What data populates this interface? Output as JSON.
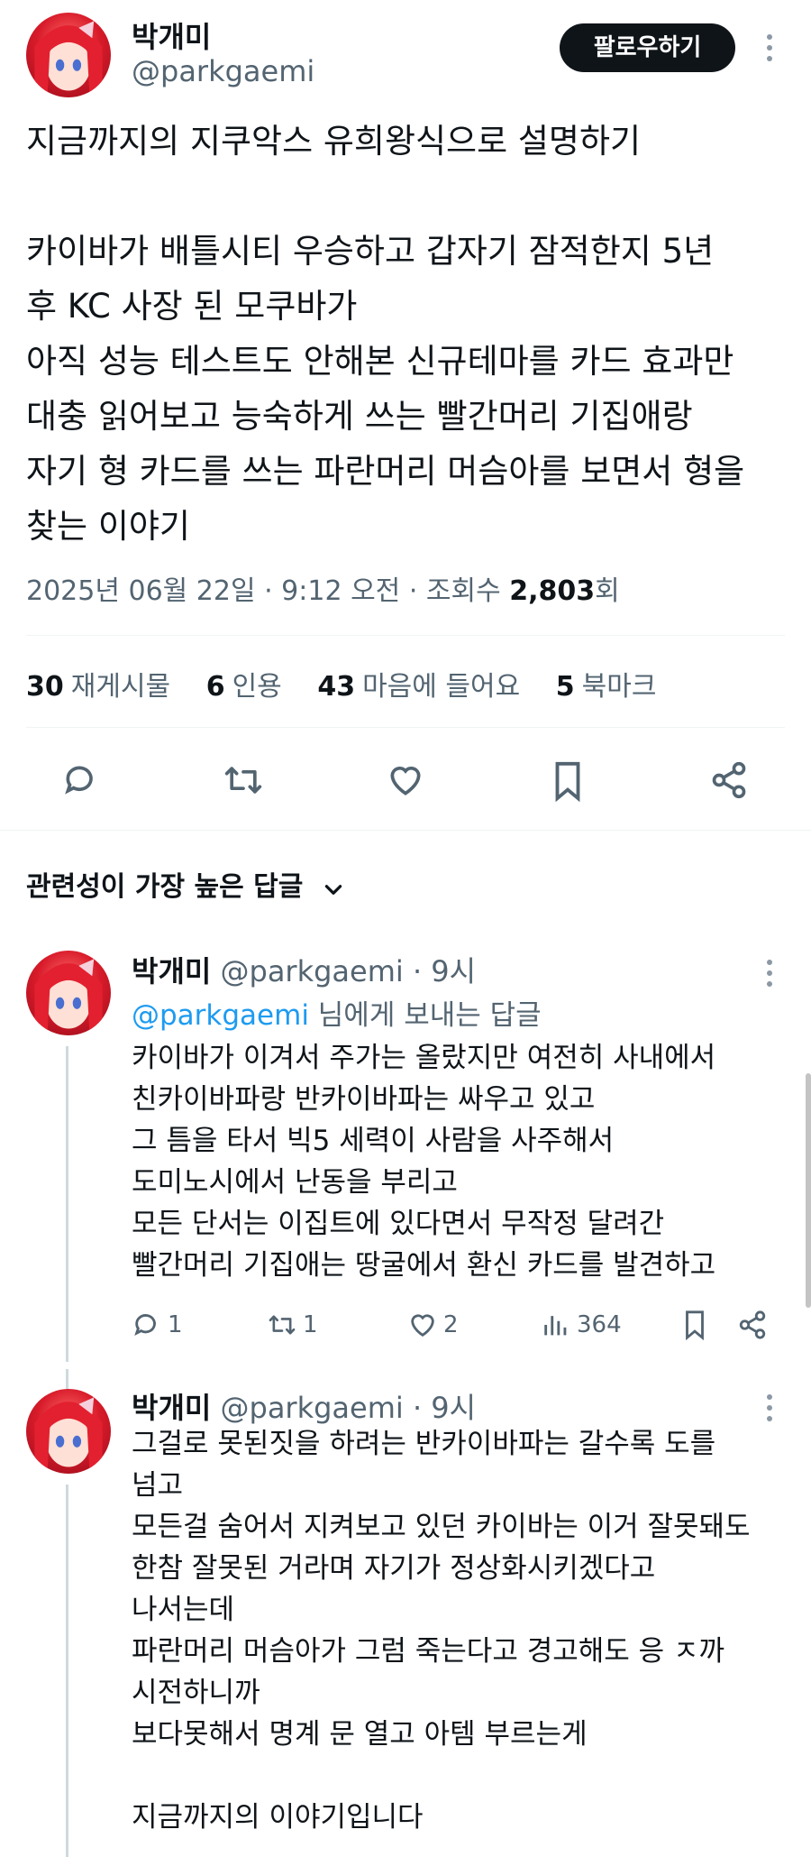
{
  "tweet": {
    "author_name": "박개미",
    "author_handle": "@parkgaemi",
    "follow_label": "팔로우하기",
    "text": "지금까지의 지쿠악스 유희왕식으로 설명하기\n\n카이바가 배틀시티 우승하고 갑자기 잠적한지 5년\n후 KC 사장 된 모쿠바가\n아직 성능 테스트도 안해본 신규테마를 카드 효과만\n대충 읽어보고 능숙하게 쓰는 빨간머리 기집애랑\n자기 형 카드를 쓰는 파란머리 머슴아를 보면서 형을\n찾는 이야기",
    "date": "2025년 06월 22일 · 9:12 오전 · 조회수 ",
    "views": "2,803",
    "views_suffix": "회"
  },
  "stats": {
    "retweets_count": "30",
    "retweets_label": "재게시물",
    "quotes_count": "6",
    "quotes_label": "인용",
    "likes_count": "43",
    "likes_label": "마음에 들어요",
    "bookmarks_count": "5",
    "bookmarks_label": "북마크"
  },
  "sort": {
    "label": "관련성이 가장 높은 답글"
  },
  "replies": [
    {
      "author_name": "박개미",
      "author_handle": "@parkgaemi",
      "time": " · 9시",
      "replying_to_mention": "@parkgaemi",
      "replying_to_suffix": " 님에게 보내는 답글",
      "text": "카이바가 이겨서 주가는 올랐지만 여전히 사내에서\n친카이바파랑 반카이바파는 싸우고 있고\n그 틈을 타서 빅5 세력이 사람을 사주해서\n도미노시에서 난동을 부리고\n모든 단서는 이집트에 있다면서 무작정 달려간\n빨간머리 기집애는 땅굴에서 환신 카드를 발견하고",
      "replies_count": "1",
      "retweets_count": "1",
      "likes_count": "2",
      "views_count": "364"
    },
    {
      "author_name": "박개미",
      "author_handle": "@parkgaemi",
      "time": " · 9시",
      "text": "그걸로 못된짓을 하려는 반카이바파는 갈수록 도를\n넘고\n모든걸 숨어서 지켜보고 있던 카이바는 이거 잘못돼도\n한참 잘못된 거라며 자기가 정상화시키겠다고\n나서는데\n파란머리 머슴아가 그럼 죽는다고 경고해도 응 ㅈ까\n시전하니까\n보다못해서 명계 문 열고 아템 부르는게\n\n지금까지의 이야기입니다"
    }
  ],
  "icons": {
    "reply": "reply-icon",
    "retweet": "retweet-icon",
    "like": "heart-icon",
    "bookmark": "bookmark-icon",
    "share": "share-icon",
    "views": "views-icon",
    "more": "more-icon",
    "chevron": "chevron-down-icon",
    "avatar": "avatar"
  },
  "colors": {
    "text": "#0f1419",
    "muted": "#536471",
    "link": "#1d9bf0",
    "button": "#0f1419"
  }
}
